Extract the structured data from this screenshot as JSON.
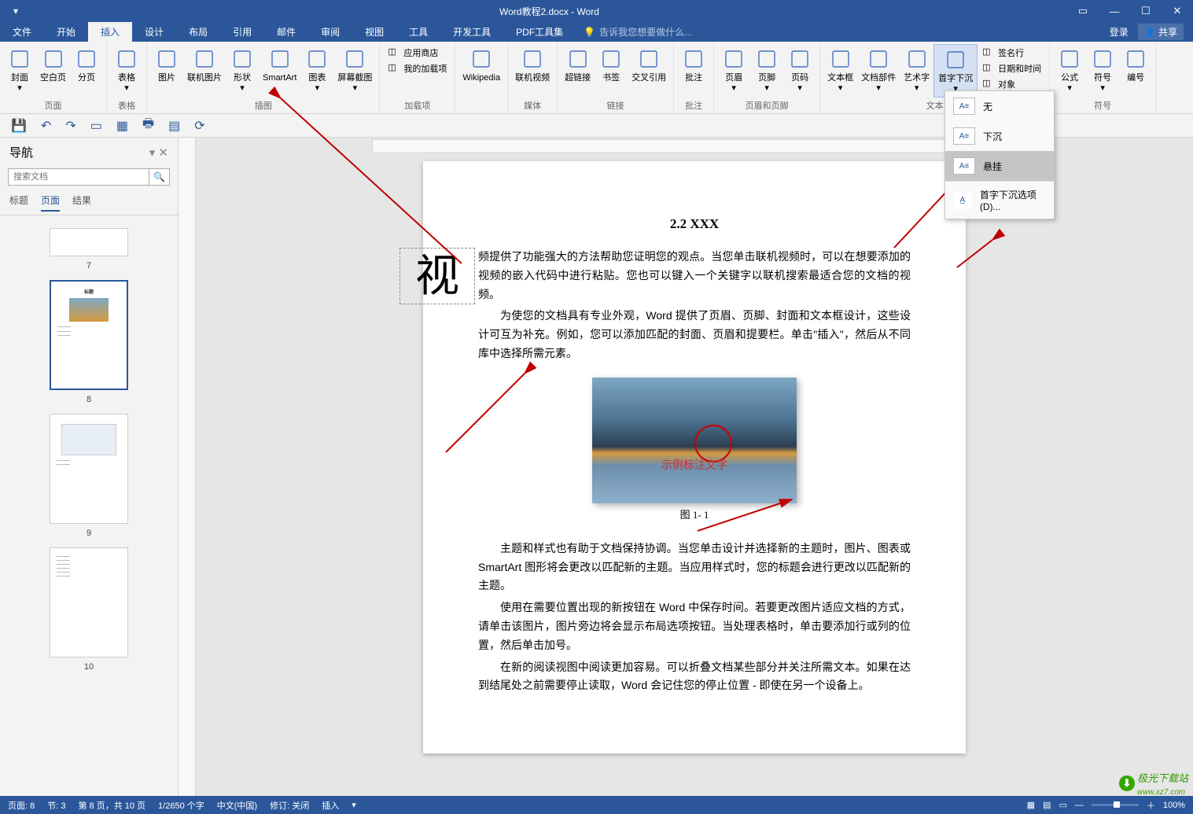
{
  "titlebar": {
    "title": "Word教程2.docx - Word"
  },
  "menu": {
    "tabs": [
      "文件",
      "开始",
      "插入",
      "设计",
      "布局",
      "引用",
      "邮件",
      "审阅",
      "视图",
      "工具",
      "开发工具",
      "PDF工具集"
    ],
    "active_index": 2,
    "tell_me_placeholder": "告诉我您想要做什么...",
    "login": "登录",
    "share": "共享"
  },
  "ribbon": {
    "groups": [
      {
        "label": "页面",
        "buttons": [
          "封面",
          "空白页",
          "分页"
        ]
      },
      {
        "label": "表格",
        "buttons": [
          "表格"
        ]
      },
      {
        "label": "插图",
        "buttons": [
          "图片",
          "联机图片",
          "形状",
          "SmartArt",
          "图表",
          "屏幕截图"
        ]
      },
      {
        "label": "加载项",
        "small": [
          "应用商店",
          "我的加载项"
        ]
      },
      {
        "label": "",
        "buttons": [
          "Wikipedia"
        ]
      },
      {
        "label": "媒体",
        "buttons": [
          "联机视频"
        ]
      },
      {
        "label": "链接",
        "buttons": [
          "超链接",
          "书签",
          "交叉引用"
        ]
      },
      {
        "label": "批注",
        "buttons": [
          "批注"
        ]
      },
      {
        "label": "页眉和页脚",
        "buttons": [
          "页眉",
          "页脚",
          "页码"
        ]
      },
      {
        "label": "文本",
        "buttons": [
          "文本框",
          "文档部件",
          "艺术字",
          "首字下沉"
        ],
        "small": [
          "签名行",
          "日期和时间",
          "对象"
        ]
      },
      {
        "label": "符号",
        "buttons": [
          "公式",
          "符号",
          "编号"
        ]
      }
    ]
  },
  "dropdown": {
    "items": [
      "无",
      "下沉",
      "悬挂"
    ],
    "hover_index": 2,
    "options_label": "首字下沉选项(D)..."
  },
  "nav": {
    "title": "导航",
    "search_placeholder": "搜索文档",
    "tabs": [
      "标题",
      "页面",
      "结果"
    ],
    "active_tab": 1,
    "thumbs": [
      {
        "num": "7",
        "sel": false,
        "tall": false
      },
      {
        "num": "8",
        "sel": true,
        "tall": true
      },
      {
        "num": "9",
        "sel": false,
        "tall": true
      },
      {
        "num": "10",
        "sel": false,
        "tall": true
      }
    ]
  },
  "document": {
    "heading": "2.2 XXX",
    "dropcap": "视",
    "para1_line1": "频提供了功能强大的方法帮助您证明您的观点。当您单击联机视频时，可以在想",
    "para1_line2": "要添加的视频的嵌入代码中进行粘贴。您也可以键入一个关键字以联机搜索最适",
    "para1_line3": "合您的文档的视频。",
    "para2": "为使您的文档具有专业外观，Word 提供了页眉、页脚、封面和文本框设计，这些设计可互为补充。例如，您可以添加匹配的封面、页眉和提要栏。单击\"插入\"，然后从不同库中选择所需元素。",
    "image_caption_in": "示例标注文字",
    "image_caption": "图 1- 1",
    "para3": "主题和样式也有助于文档保持协调。当您单击设计并选择新的主题时，图片、图表或 SmartArt 图形将会更改以匹配新的主题。当应用样式时，您的标题会进行更改以匹配新的主题。",
    "para4": "使用在需要位置出现的新按钮在 Word 中保存时间。若要更改图片适应文档的方式，请单击该图片，图片旁边将会显示布局选项按钮。当处理表格时，单击要添加行或列的位置，然后单击加号。",
    "para5": "在新的阅读视图中阅读更加容易。可以折叠文档某些部分并关注所需文本。如果在达到结尾处之前需要停止读取，Word 会记住您的停止位置 - 即使在另一个设备上。"
  },
  "status": {
    "page": "页面: 8",
    "section": "节: 3",
    "pages": "第 8 页，共 10 页",
    "words": "1/2650 个字",
    "lang": "中文(中国)",
    "track": "修订: 关闭",
    "mode": "插入",
    "zoom": "100%"
  },
  "watermark": {
    "brand": "极光下载站",
    "url": "www.xz7.com"
  }
}
